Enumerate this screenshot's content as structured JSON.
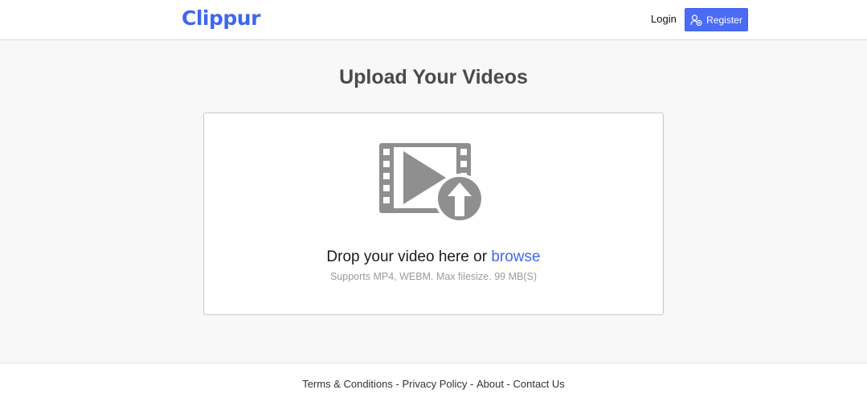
{
  "header": {
    "logo_text": "Clippur",
    "login_label": "Login",
    "register_label": "Register"
  },
  "main": {
    "title": "Upload Your Videos",
    "drop_text": "Drop your video here or ",
    "browse_label": "browse",
    "supports_text": "Supports MP4, WEBM. Max filesize. 99 MB(S)"
  },
  "footer": {
    "links": [
      "Terms & Conditions",
      "Privacy Policy",
      "About",
      "Contact Us"
    ],
    "separator": " - "
  },
  "icons": {
    "register": "user-add-icon",
    "upload": "video-upload-icon"
  },
  "colors": {
    "brand": "#3f67f0",
    "register_button": "#4a6cf4",
    "icon_gray": "#8f8f8f",
    "page_background": "#f8f8f8"
  }
}
